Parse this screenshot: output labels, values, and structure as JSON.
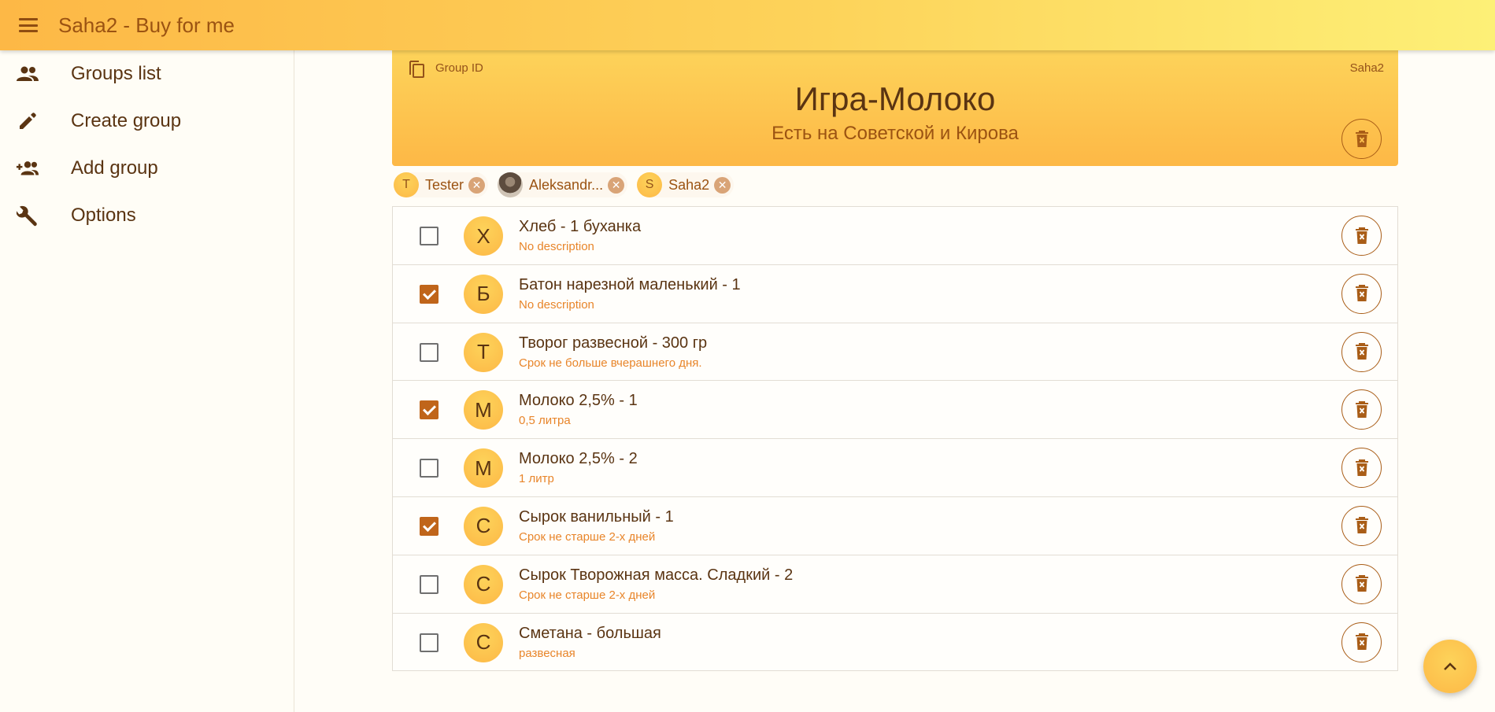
{
  "app": {
    "title": "Saha2 - Buy for me",
    "accent": "#fdb846",
    "brand_dark": "#5a3412",
    "check_color": "#c0651a"
  },
  "sidebar": {
    "items": [
      {
        "label": "Groups list",
        "icon": "group-icon"
      },
      {
        "label": "Create group",
        "icon": "pencil-icon"
      },
      {
        "label": "Add group",
        "icon": "add-person-icon"
      },
      {
        "label": "Options",
        "icon": "wrench-icon"
      }
    ]
  },
  "group": {
    "id_label": "Group ID",
    "owner": "Saha2",
    "title": "Игра-Молоко",
    "description": "Есть на Советской и Кирова"
  },
  "members": [
    {
      "initial": "T",
      "name": "Tester",
      "has_photo": false
    },
    {
      "initial": "",
      "name": "Aleksandr...",
      "has_photo": true
    },
    {
      "initial": "S",
      "name": "Saha2",
      "has_photo": false
    }
  ],
  "items": [
    {
      "checked": false,
      "letter": "Х",
      "title": "Хлеб - 1 буханка",
      "description": "No description"
    },
    {
      "checked": true,
      "letter": "Б",
      "title": "Батон нарезной маленький - 1",
      "description": "No description"
    },
    {
      "checked": false,
      "letter": "Т",
      "title": "Творог развесной - 300 гр",
      "description": "Срок не больше вчерашнего дня."
    },
    {
      "checked": true,
      "letter": "М",
      "title": "Молоко 2,5% - 1",
      "description": "0,5 литра"
    },
    {
      "checked": false,
      "letter": "М",
      "title": "Молоко 2,5% - 2",
      "description": "1 литр"
    },
    {
      "checked": true,
      "letter": "С",
      "title": "Сырок ванильный - 1",
      "description": "Срок не старше 2-х дней"
    },
    {
      "checked": false,
      "letter": "С",
      "title": "Сырок Творожная масса. Сладкий - 2",
      "description": "Срок не старше 2-х дней"
    },
    {
      "checked": false,
      "letter": "С",
      "title": "Сметана - большая",
      "description": "развесная"
    }
  ]
}
